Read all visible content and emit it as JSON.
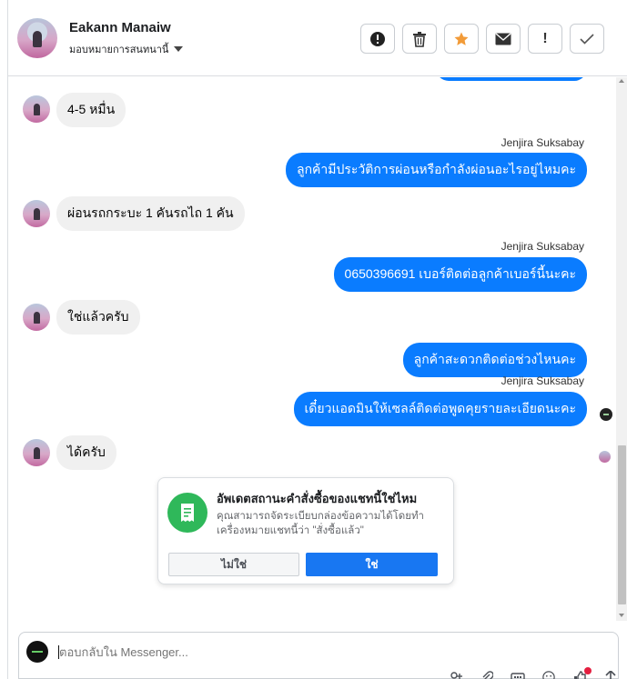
{
  "header": {
    "name": "Eakann Manaiw",
    "assign_label": "มอบหมายการสนทนานี้",
    "tools": [
      {
        "icon": "alert-circle-icon",
        "glyph": "⓿"
      },
      {
        "icon": "trash-icon",
        "glyph": "🗑"
      },
      {
        "icon": "star-icon",
        "glyph": "★"
      },
      {
        "icon": "envelope-icon",
        "glyph": "✉"
      },
      {
        "icon": "exclamation-icon",
        "glyph": "!"
      },
      {
        "icon": "check-icon",
        "glyph": "✓"
      }
    ]
  },
  "messages": [
    {
      "dir": "in",
      "text": "4-5 หมื่น"
    },
    {
      "dir": "out",
      "sender": "Jenjira Suksabay",
      "text": "ลูกค้ามีประวัติการผ่อนหรือกำลังผ่อนอะไรอยู่ไหมคะ"
    },
    {
      "dir": "in",
      "text": "ผ่อนรถกระบะ 1 คันรถไถ 1 คัน"
    },
    {
      "dir": "out",
      "sender": "Jenjira Suksabay",
      "text": "0650396691 เบอร์ติดต่อลูกค้าเบอร์นี้นะคะ"
    },
    {
      "dir": "in",
      "text": "ใช่แล้วครับ"
    },
    {
      "dir": "out",
      "text": "ลูกค้าสะดวกติดต่อช่วงไหนคะ"
    },
    {
      "dir": "out",
      "sender": "Jenjira Suksabay",
      "text": "เดี๋ยวแอดมินให้เซลล์ติดต่อพูดคุยรายละเอียดนะคะ"
    },
    {
      "dir": "in",
      "text": "ได้ครับ"
    }
  ],
  "prompt_card": {
    "title": "อัพเดตสถานะคำสั่งซื้อของแชทนี้ใช่ไหม",
    "description": "คุณสามารถจัดระเบียบกล่องข้อความได้โดยทำเครื่องหมายแชทนี้ว่า \"สั่งซื้อแล้ว\"",
    "no_label": "ไม่ใช่",
    "yes_label": "ใช่"
  },
  "composer": {
    "placeholder": "ตอบกลับใน Messenger..."
  },
  "colors": {
    "outgoing_bubble": "#0a7cff",
    "incoming_bubble": "#f0f0f0",
    "primary_button": "#1877f2",
    "card_icon": "#2fb85a",
    "star": "#f29b38"
  }
}
